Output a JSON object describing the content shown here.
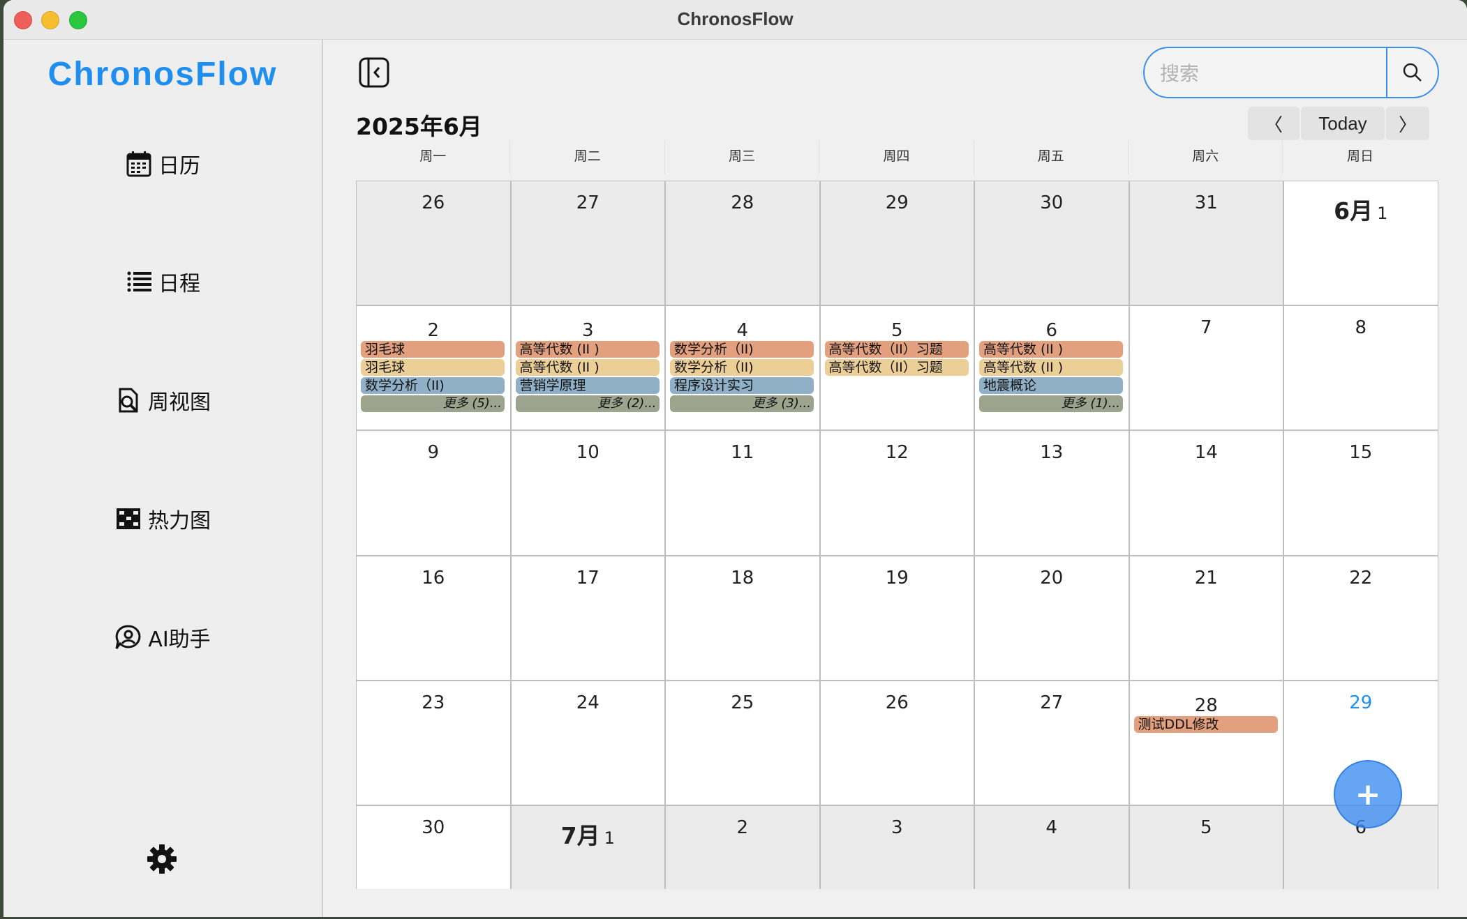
{
  "window": {
    "title": "ChronosFlow"
  },
  "sidebar": {
    "logo": "ChronosFlow",
    "items": [
      {
        "label": "日历",
        "icon": "calendar-icon"
      },
      {
        "label": "日程",
        "icon": "list-icon"
      },
      {
        "label": "周视图",
        "icon": "week-view-icon"
      },
      {
        "label": "热力图",
        "icon": "heatmap-icon"
      },
      {
        "label": "AI助手",
        "icon": "ai-assistant-icon"
      }
    ],
    "settings_icon": "gear-icon"
  },
  "toolbar": {
    "search_placeholder": "搜索",
    "search_value": "",
    "prev_label": "〈",
    "today_label": "Today",
    "next_label": "〉"
  },
  "calendar": {
    "month_title": "2025年6月",
    "weekdays": [
      "周一",
      "周二",
      "周三",
      "周四",
      "周五",
      "周六",
      "周日"
    ],
    "weeks": [
      [
        {
          "label": "26",
          "inMonth": false
        },
        {
          "label": "27",
          "inMonth": false
        },
        {
          "label": "28",
          "inMonth": false
        },
        {
          "label": "29",
          "inMonth": false
        },
        {
          "label": "30",
          "inMonth": false
        },
        {
          "label": "31",
          "inMonth": false
        },
        {
          "label": "1",
          "month": "6月",
          "inMonth": true
        }
      ],
      [
        {
          "label": "2",
          "inMonth": true,
          "events": [
            {
              "title": "羽毛球",
              "color": "#e3a07e"
            },
            {
              "title": "羽毛球",
              "color": "#ebcf97"
            },
            {
              "title": "数学分析（II)",
              "color": "#8fb0c6"
            },
            {
              "title": "更多 (5)...",
              "color": "#9da48e",
              "more": true
            }
          ]
        },
        {
          "label": "3",
          "inMonth": true,
          "events": [
            {
              "title": "高等代数 (II )",
              "color": "#e3a07e"
            },
            {
              "title": "高等代数 (II )",
              "color": "#ebcf97"
            },
            {
              "title": "营销学原理",
              "color": "#8fb0c6"
            },
            {
              "title": "更多 (2)...",
              "color": "#9da48e",
              "more": true
            }
          ]
        },
        {
          "label": "4",
          "inMonth": true,
          "events": [
            {
              "title": "数学分析（II)",
              "color": "#e3a07e"
            },
            {
              "title": "数学分析（II)",
              "color": "#ebcf97"
            },
            {
              "title": "程序设计实习",
              "color": "#8fb0c6"
            },
            {
              "title": "更多 (3)...",
              "color": "#9da48e",
              "more": true
            }
          ]
        },
        {
          "label": "5",
          "inMonth": true,
          "events": [
            {
              "title": "高等代数（II）习题",
              "color": "#e3a07e"
            },
            {
              "title": "高等代数（II）习题",
              "color": "#ebcf97"
            }
          ]
        },
        {
          "label": "6",
          "inMonth": true,
          "events": [
            {
              "title": "高等代数 (II )",
              "color": "#e3a07e"
            },
            {
              "title": "高等代数 (II )",
              "color": "#ebcf97"
            },
            {
              "title": "地震概论",
              "color": "#8fb0c6"
            },
            {
              "title": "更多 (1)...",
              "color": "#9da48e",
              "more": true
            }
          ]
        },
        {
          "label": "7",
          "inMonth": true
        },
        {
          "label": "8",
          "inMonth": true
        }
      ],
      [
        {
          "label": "9",
          "inMonth": true
        },
        {
          "label": "10",
          "inMonth": true
        },
        {
          "label": "11",
          "inMonth": true
        },
        {
          "label": "12",
          "inMonth": true
        },
        {
          "label": "13",
          "inMonth": true
        },
        {
          "label": "14",
          "inMonth": true
        },
        {
          "label": "15",
          "inMonth": true
        }
      ],
      [
        {
          "label": "16",
          "inMonth": true
        },
        {
          "label": "17",
          "inMonth": true
        },
        {
          "label": "18",
          "inMonth": true
        },
        {
          "label": "19",
          "inMonth": true
        },
        {
          "label": "20",
          "inMonth": true
        },
        {
          "label": "21",
          "inMonth": true
        },
        {
          "label": "22",
          "inMonth": true
        }
      ],
      [
        {
          "label": "23",
          "inMonth": true
        },
        {
          "label": "24",
          "inMonth": true
        },
        {
          "label": "25",
          "inMonth": true
        },
        {
          "label": "26",
          "inMonth": true
        },
        {
          "label": "27",
          "inMonth": true
        },
        {
          "label": "28",
          "inMonth": true,
          "events": [
            {
              "title": "测试DDL修改",
              "color": "#e3a07e"
            }
          ]
        },
        {
          "label": "29",
          "inMonth": true,
          "today": true
        }
      ],
      [
        {
          "label": "30",
          "inMonth": true
        },
        {
          "label": "1",
          "month": "7月",
          "inMonth": false
        },
        {
          "label": "2",
          "inMonth": false
        },
        {
          "label": "3",
          "inMonth": false
        },
        {
          "label": "4",
          "inMonth": false
        },
        {
          "label": "5",
          "inMonth": false
        },
        {
          "label": "6",
          "inMonth": false
        }
      ]
    ],
    "today_color": "#1e8ff0"
  },
  "fab": {
    "label": "+"
  },
  "colors": {
    "accent": "#1e8ff0",
    "search_border": "#3b8fe6"
  }
}
